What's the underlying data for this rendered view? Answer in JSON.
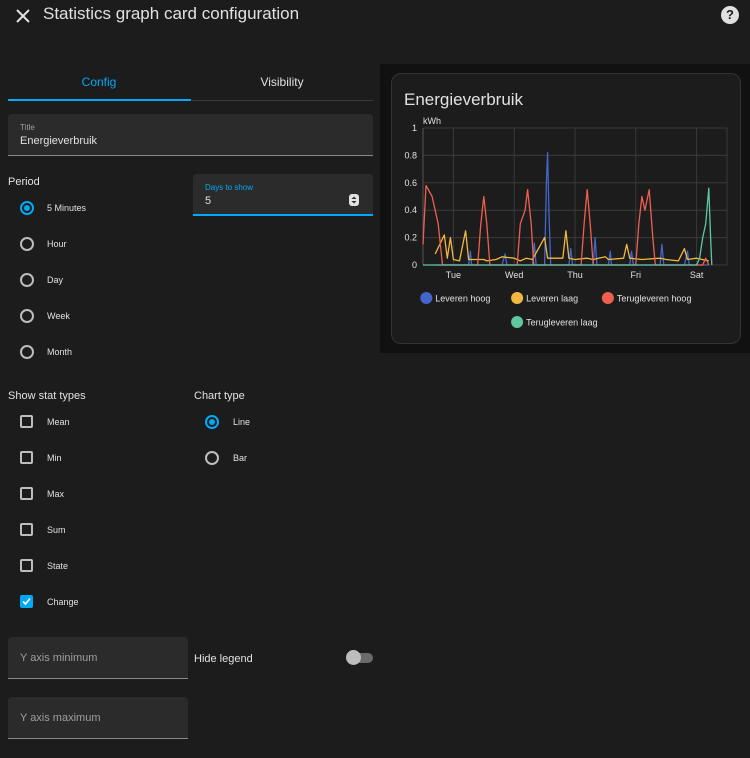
{
  "header": {
    "title": "Statistics graph card configuration"
  },
  "tabs": [
    {
      "label": "Config",
      "active": true
    },
    {
      "label": "Visibility",
      "active": false
    }
  ],
  "title_field": {
    "label": "Title",
    "value": "Energieverbruik"
  },
  "period": {
    "label": "Period",
    "options": [
      "5 Minutes",
      "Hour",
      "Day",
      "Week",
      "Month"
    ],
    "selected": "5 Minutes"
  },
  "days_field": {
    "label": "Days to show",
    "value": "5"
  },
  "stat_types": {
    "label": "Show stat types",
    "options": [
      "Mean",
      "Min",
      "Max",
      "Sum",
      "State",
      "Change"
    ],
    "checked": [
      "Change"
    ]
  },
  "chart_type": {
    "label": "Chart type",
    "options": [
      "Line",
      "Bar"
    ],
    "selected": "Line"
  },
  "y_min": {
    "placeholder": "Y axis minimum"
  },
  "y_max": {
    "placeholder": "Y axis maximum"
  },
  "hide_legend": {
    "label": "Hide legend",
    "enabled": false
  },
  "colors": {
    "accent": "#03a9f4",
    "background": "#1c1c1c"
  },
  "chart_data": {
    "type": "line",
    "title": "Energieverbruik",
    "ylabel": "kWh",
    "ylim": [
      0,
      1
    ],
    "yticks": [
      "0",
      "0.2",
      "0.4",
      "0.6",
      "0.8",
      "1"
    ],
    "xticks": [
      "Tue",
      "Wed",
      "Thu",
      "Fri",
      "Sat"
    ],
    "xlim": [
      0,
      5
    ],
    "grid": true,
    "legend_position": "bottom",
    "series": [
      {
        "name": "Leveren hoog",
        "color": "#4466cc",
        "points": [
          [
            0.2,
            0
          ],
          [
            0.75,
            0
          ],
          [
            0.78,
            0.1
          ],
          [
            0.8,
            0
          ],
          [
            1.3,
            0
          ],
          [
            1.35,
            0.08
          ],
          [
            1.38,
            0
          ],
          [
            1.8,
            0
          ],
          [
            1.83,
            0.16
          ],
          [
            1.86,
            0
          ],
          [
            2.0,
            0
          ],
          [
            2.03,
            0.6
          ],
          [
            2.05,
            0.82
          ],
          [
            2.07,
            0.4
          ],
          [
            2.1,
            0
          ],
          [
            2.4,
            0
          ],
          [
            2.43,
            0.12
          ],
          [
            2.46,
            0
          ],
          [
            2.8,
            0
          ],
          [
            2.83,
            0.2
          ],
          [
            2.86,
            0
          ],
          [
            3.05,
            0
          ],
          [
            3.08,
            0.1
          ],
          [
            3.1,
            0
          ],
          [
            3.4,
            0
          ],
          [
            3.43,
            0.1
          ],
          [
            3.46,
            0
          ],
          [
            3.9,
            0
          ],
          [
            3.93,
            0.15
          ],
          [
            3.96,
            0
          ],
          [
            4.3,
            0
          ],
          [
            4.35,
            0.1
          ],
          [
            4.38,
            0
          ],
          [
            4.7,
            0
          ]
        ]
      },
      {
        "name": "Leveren laag",
        "color": "#f0b840",
        "points": [
          [
            0.2,
            0.08
          ],
          [
            0.35,
            0.22
          ],
          [
            0.4,
            0.05
          ],
          [
            0.45,
            0.2
          ],
          [
            0.5,
            0.04
          ],
          [
            0.6,
            0.03
          ],
          [
            0.7,
            0.25
          ],
          [
            0.75,
            0.04
          ],
          [
            1.0,
            0.04
          ],
          [
            1.05,
            0.03
          ],
          [
            1.2,
            0.04
          ],
          [
            1.3,
            0.06
          ],
          [
            1.5,
            0.05
          ],
          [
            1.6,
            0.03
          ],
          [
            1.7,
            0.05
          ],
          [
            1.8,
            0.04
          ],
          [
            2.0,
            0.2
          ],
          [
            2.05,
            0.05
          ],
          [
            2.3,
            0.05
          ],
          [
            2.35,
            0.25
          ],
          [
            2.4,
            0.05
          ],
          [
            2.5,
            0.04
          ],
          [
            2.7,
            0.05
          ],
          [
            2.8,
            0.04
          ],
          [
            3.0,
            0.06
          ],
          [
            3.05,
            0.04
          ],
          [
            3.3,
            0.05
          ],
          [
            3.35,
            0.15
          ],
          [
            3.4,
            0.05
          ],
          [
            3.6,
            0.04
          ],
          [
            3.9,
            0.05
          ],
          [
            4.0,
            0.04
          ],
          [
            4.2,
            0.03
          ],
          [
            4.3,
            0.12
          ],
          [
            4.35,
            0.04
          ],
          [
            4.5,
            0.05
          ],
          [
            4.7,
            0.03
          ]
        ]
      },
      {
        "name": "Terugleveren hoog",
        "color": "#ee5f4f",
        "points": [
          [
            0,
            0.15
          ],
          [
            0.05,
            0.58
          ],
          [
            0.15,
            0.5
          ],
          [
            0.25,
            0.3
          ],
          [
            0.32,
            0
          ],
          [
            0.9,
            0
          ],
          [
            0.95,
            0.3
          ],
          [
            1.0,
            0.5
          ],
          [
            1.05,
            0.3
          ],
          [
            1.1,
            0
          ],
          [
            1.3,
            0
          ],
          [
            1.55,
            0
          ],
          [
            1.6,
            0.3
          ],
          [
            1.68,
            0.4
          ],
          [
            1.72,
            0.55
          ],
          [
            1.78,
            0.3
          ],
          [
            1.82,
            0
          ],
          [
            2.0,
            0
          ],
          [
            2.6,
            0
          ],
          [
            2.65,
            0.3
          ],
          [
            2.7,
            0.55
          ],
          [
            2.75,
            0.3
          ],
          [
            2.8,
            0
          ],
          [
            3.0,
            0
          ],
          [
            3.5,
            0
          ],
          [
            3.55,
            0.3
          ],
          [
            3.6,
            0.5
          ],
          [
            3.65,
            0.4
          ],
          [
            3.72,
            0.55
          ],
          [
            3.78,
            0.2
          ],
          [
            3.82,
            0
          ],
          [
            4.0,
            0
          ],
          [
            4.6,
            0
          ],
          [
            4.65,
            0.05
          ],
          [
            4.7,
            0
          ]
        ]
      },
      {
        "name": "Terugleveren laag",
        "color": "#5fc7a0",
        "points": [
          [
            0,
            0
          ],
          [
            4.5,
            0
          ],
          [
            4.55,
            0.05
          ],
          [
            4.6,
            0.2
          ],
          [
            4.65,
            0.3
          ],
          [
            4.7,
            0.56
          ],
          [
            4.73,
            0.2
          ],
          [
            4.75,
            0
          ]
        ]
      }
    ]
  }
}
